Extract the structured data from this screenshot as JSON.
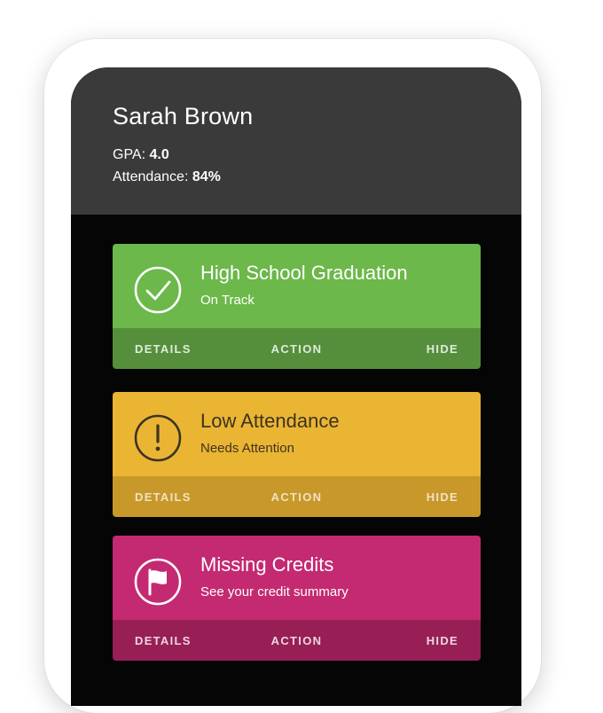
{
  "student": {
    "name": "Sarah Brown",
    "gpa_label": "GPA:",
    "gpa_value": "4.0",
    "attendance_label": "Attendance:",
    "attendance_value": "84%"
  },
  "cards": [
    {
      "title": "High School Graduation",
      "subtitle": "On Track",
      "icon": "check-circle-icon",
      "color": "#6cb84a",
      "actions": [
        "DETAILS",
        "ACTION",
        "HIDE"
      ]
    },
    {
      "title": "Low Attendance",
      "subtitle": "Needs Attention",
      "icon": "exclamation-circle-icon",
      "color": "#ebb534",
      "actions": [
        "DETAILS",
        "ACTION",
        "HIDE"
      ]
    },
    {
      "title": "Missing Credits",
      "subtitle": "See your credit summary",
      "icon": "flag-circle-icon",
      "color": "#c42a71",
      "actions": [
        "DETAILS",
        "ACTION",
        "HIDE"
      ]
    }
  ]
}
